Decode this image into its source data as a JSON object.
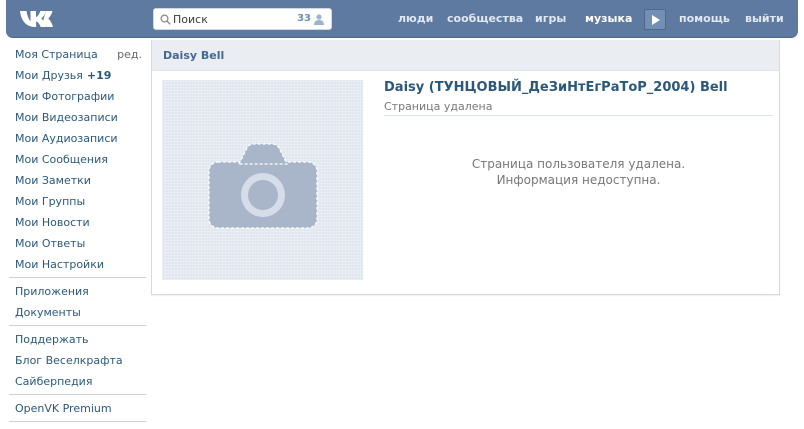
{
  "header": {
    "search": {
      "placeholder": "Поиск",
      "count": "33"
    },
    "nav": [
      {
        "label": "люди"
      },
      {
        "label": "сообщества"
      },
      {
        "label": "игры"
      },
      {
        "label": "музыка"
      },
      {
        "label": "помощь"
      },
      {
        "label": "выйти"
      }
    ],
    "active_nav": "музыка"
  },
  "sidebar": {
    "edit_label": "ред.",
    "items": [
      {
        "label": "Моя Страница"
      },
      {
        "label": "Мои Друзья",
        "count": "+19"
      },
      {
        "label": "Мои Фотографии"
      },
      {
        "label": "Мои Видеозаписи"
      },
      {
        "label": "Мои Аудиозаписи"
      },
      {
        "label": "Мои Сообщения"
      },
      {
        "label": "Мои Заметки"
      },
      {
        "label": "Мои Группы"
      },
      {
        "label": "Мои Новости"
      },
      {
        "label": "Мои Ответы"
      },
      {
        "label": "Мои Настройки"
      }
    ],
    "group2": [
      {
        "label": "Приложения"
      },
      {
        "label": "Документы"
      }
    ],
    "group3": [
      {
        "label": "Поддержать"
      },
      {
        "label": "Блог Веселкрафта"
      },
      {
        "label": "Сайберпедия"
      }
    ],
    "group4": [
      {
        "label": "OpenVK Premium"
      }
    ]
  },
  "profile": {
    "header_name": "Daisy Bell",
    "full_name": "Daisy (ТУНЦОВЫЙ_ДеЗиНтЕгРаТоР_2004) Bell",
    "status": "Страница удалена",
    "message_line1": "Страница пользователя удалена.",
    "message_line2": "Информация недоступна."
  },
  "colors": {
    "header_bg": "#5e7aa0",
    "link": "#2b587a",
    "card_head_bg": "#eaeef3"
  }
}
